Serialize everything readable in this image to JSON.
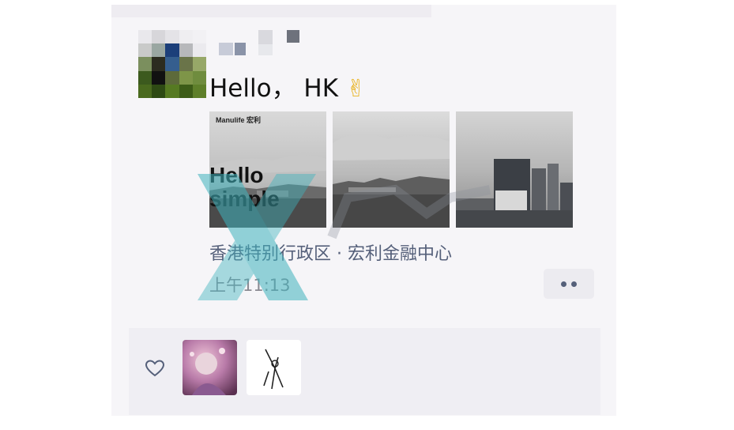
{
  "post": {
    "text": "Hello，  HK",
    "emoji_icon": "victory-hand-icon",
    "emoji_glyph": "✌",
    "photo1_brand": "Manulife 宏利",
    "photo1_overlay": "Hello\nsimple",
    "location": "香港特别行政区 · 宏利金融中心",
    "time": "上午11:13"
  },
  "likes": {
    "heart_icon": "heart-icon"
  },
  "colors": {
    "card_bg": "#f6f5f8",
    "link_blue": "#55607a",
    "time_gray": "#8a8a92",
    "watermark_teal": "#3fb3bd"
  }
}
